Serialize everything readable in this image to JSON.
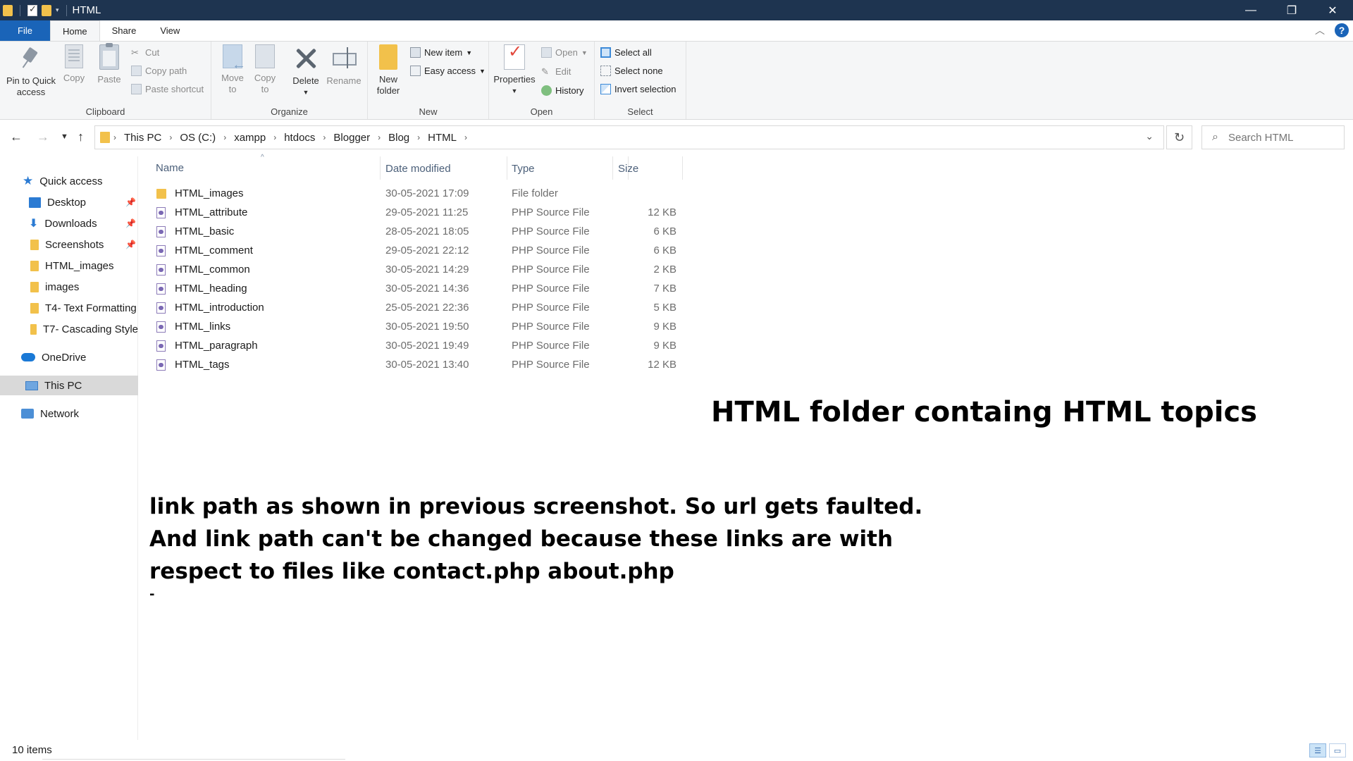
{
  "window": {
    "title": "HTML",
    "minimize": "—",
    "restore": "❐",
    "close": "✕"
  },
  "ribbon_tabs": [
    {
      "label": "File"
    },
    {
      "label": "Home"
    },
    {
      "label": "Share"
    },
    {
      "label": "View"
    }
  ],
  "ribbon": {
    "clipboard": {
      "label": "Clipboard",
      "pin": "Pin to Quick access",
      "pin_line1": "Pin to Quick",
      "pin_line2": "access",
      "copy": "Copy",
      "paste": "Paste",
      "cut": "Cut",
      "copy_path": "Copy path",
      "paste_shortcut": "Paste shortcut"
    },
    "organize": {
      "label": "Organize",
      "move_to_line1": "Move",
      "move_to_line2": "to",
      "copy_to_line1": "Copy",
      "copy_to_line2": "to",
      "delete": "Delete",
      "rename": "Rename"
    },
    "new": {
      "label": "New",
      "new_folder_line1": "New",
      "new_folder_line2": "folder",
      "new_item": "New item",
      "easy_access": "Easy access"
    },
    "open": {
      "label": "Open",
      "properties": "Properties",
      "open": "Open",
      "edit": "Edit",
      "history": "History"
    },
    "select": {
      "label": "Select",
      "select_all": "Select all",
      "select_none": "Select none",
      "invert_selection": "Invert selection"
    }
  },
  "address": {
    "crumbs": [
      "This PC",
      "OS (C:)",
      "xampp",
      "htdocs",
      "Blogger",
      "Blog",
      "HTML"
    ],
    "search_placeholder": "Search HTML"
  },
  "nav": {
    "quick_access": "Quick access",
    "items": [
      {
        "label": "Desktop",
        "icon": "desktop-icon",
        "pinned": true
      },
      {
        "label": "Downloads",
        "icon": "download-icon",
        "pinned": true
      },
      {
        "label": "Screenshots",
        "icon": "folder-icon",
        "pinned": true
      },
      {
        "label": "HTML_images",
        "icon": "folder-icon",
        "pinned": false
      },
      {
        "label": "images",
        "icon": "folder-icon",
        "pinned": false
      },
      {
        "label": "T4- Text Formatting",
        "icon": "folder-icon",
        "pinned": false
      },
      {
        "label": "T7- Cascading Style",
        "icon": "folder-icon",
        "pinned": false
      }
    ],
    "onedrive": "OneDrive",
    "this_pc": "This PC",
    "network": "Network"
  },
  "columns": {
    "name": "Name",
    "date_modified": "Date modified",
    "type": "Type",
    "size": "Size"
  },
  "files": [
    {
      "name": "HTML_images",
      "date": "30-05-2021 17:09",
      "type": "File folder",
      "size": "",
      "icon": "folder-icon"
    },
    {
      "name": "HTML_attribute",
      "date": "29-05-2021 11:25",
      "type": "PHP Source File",
      "size": "12 KB",
      "icon": "php-file-icon"
    },
    {
      "name": "HTML_basic",
      "date": "28-05-2021 18:05",
      "type": "PHP Source File",
      "size": "6 KB",
      "icon": "php-file-icon"
    },
    {
      "name": "HTML_comment",
      "date": "29-05-2021 22:12",
      "type": "PHP Source File",
      "size": "6 KB",
      "icon": "php-file-icon"
    },
    {
      "name": "HTML_common",
      "date": "30-05-2021 14:29",
      "type": "PHP Source File",
      "size": "2 KB",
      "icon": "php-file-icon"
    },
    {
      "name": "HTML_heading",
      "date": "30-05-2021 14:36",
      "type": "PHP Source File",
      "size": "7 KB",
      "icon": "php-file-icon"
    },
    {
      "name": "HTML_introduction",
      "date": "25-05-2021 22:36",
      "type": "PHP Source File",
      "size": "5 KB",
      "icon": "php-file-icon"
    },
    {
      "name": "HTML_links",
      "date": "30-05-2021 19:50",
      "type": "PHP Source File",
      "size": "9 KB",
      "icon": "php-file-icon"
    },
    {
      "name": "HTML_paragraph",
      "date": "30-05-2021 19:49",
      "type": "PHP Source File",
      "size": "9 KB",
      "icon": "php-file-icon"
    },
    {
      "name": "HTML_tags",
      "date": "30-05-2021 13:40",
      "type": "PHP Source File",
      "size": "12 KB",
      "icon": "php-file-icon"
    }
  ],
  "annotation": {
    "title": "HTML folder containg HTML topics",
    "body": "link path as shown in previous screenshot. So url gets faulted. And link path can't be changed because these links are with respect to files like contact.php about.php",
    "trailing": "-"
  },
  "status": {
    "item_count": "10 items"
  }
}
